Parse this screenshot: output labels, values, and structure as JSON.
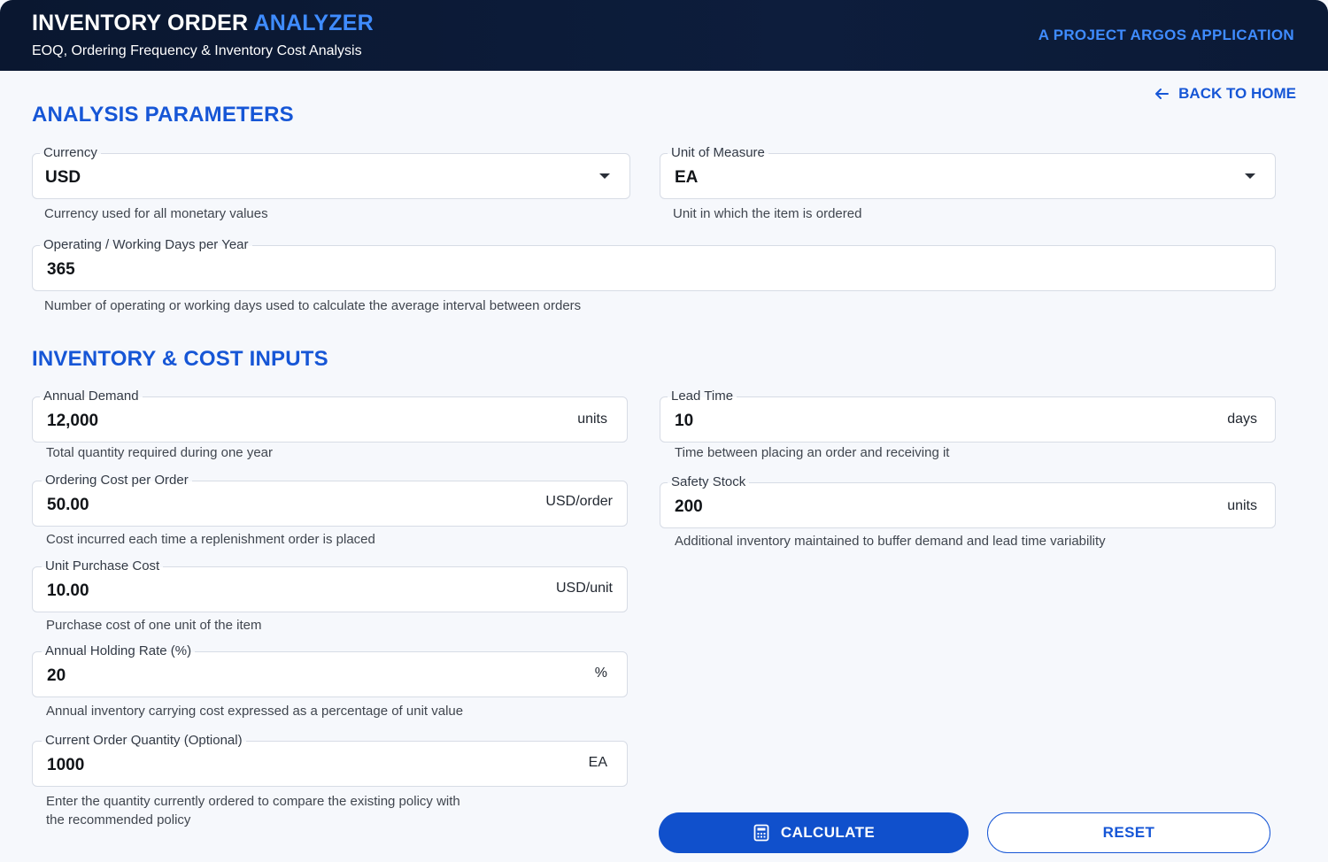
{
  "header": {
    "title_main": "INVENTORY ORDER",
    "title_accent": "ANALYZER",
    "subtitle": "EOQ, Ordering Frequency & Inventory Cost Analysis",
    "brand": "A PROJECT ARGOS APPLICATION"
  },
  "nav": {
    "back_label": "BACK TO HOME"
  },
  "analysis": {
    "section_title": "ANALYSIS PARAMETERS",
    "currency": {
      "label": "Currency",
      "value": "USD",
      "helper": "Currency used for all monetary values"
    },
    "uom": {
      "label": "Unit of Measure",
      "value": "EA",
      "helper": "Unit in which the item is ordered"
    },
    "days": {
      "label": "Operating / Working Days per Year",
      "value": "365",
      "helper": "Number of operating or working days used to calculate the average interval between orders"
    }
  },
  "inputs": {
    "section_title": "INVENTORY & COST INPUTS",
    "annual_demand": {
      "label": "Annual Demand",
      "value": "12,000",
      "unit": "units",
      "helper": "Total quantity required during one year"
    },
    "lead_time": {
      "label": "Lead Time",
      "value": "10",
      "unit": "days",
      "helper": "Time between placing an order and receiving it"
    },
    "ordering_cost": {
      "label": "Ordering Cost per Order",
      "value": "50.00",
      "unit": "USD/order",
      "helper": "Cost incurred each time a replenishment order is placed"
    },
    "safety_stock": {
      "label": "Safety Stock",
      "value": "200",
      "unit": "units",
      "helper": "Additional inventory maintained to buffer demand and lead time variability"
    },
    "unit_cost": {
      "label": "Unit Purchase Cost",
      "value": "10.00",
      "unit": "USD/unit",
      "helper": "Purchase cost of one unit of the item"
    },
    "holding_rate": {
      "label": "Annual Holding Rate (%)",
      "value": "20",
      "unit": "%",
      "helper": "Annual inventory carrying cost expressed as a percentage of unit value"
    },
    "current_qty": {
      "label": "Current Order Quantity (Optional)",
      "value": "1000",
      "unit": "EA",
      "helper_line1": "Enter the quantity currently ordered to compare the existing policy with",
      "helper_line2": "the recommended policy"
    }
  },
  "actions": {
    "calculate_label": "CALCULATE",
    "reset_label": "RESET"
  },
  "colors": {
    "header_bg": "#0b1a36",
    "accent": "#3f8cff",
    "primary": "#1656d6",
    "button_fill": "#1050cc"
  },
  "icons": {
    "back": "arrow-left-icon",
    "calculate": "calculator-icon",
    "dropdown": "caret-down-icon"
  }
}
